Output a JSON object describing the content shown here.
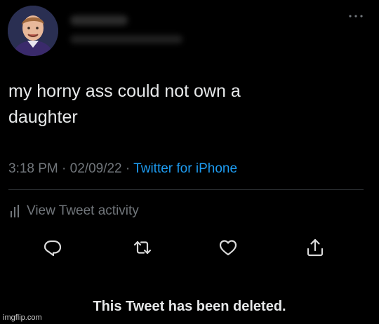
{
  "tweet": {
    "text": "my horny ass could not own a\ndaughter",
    "time": "3:18 PM",
    "separator_1": " · ",
    "date": "02/09/22",
    "separator_2": " · ",
    "source": "Twitter for iPhone"
  },
  "activity": {
    "label": "View Tweet activity"
  },
  "actions": [
    {
      "icon": "reply-icon"
    },
    {
      "icon": "retweet-icon"
    },
    {
      "icon": "like-icon"
    },
    {
      "icon": "share-icon"
    }
  ],
  "notice": {
    "text": "This Tweet has been deleted."
  },
  "watermark": {
    "text": "imgflip.com"
  },
  "colors": {
    "background": "#000000",
    "primary_text": "#e7e9ea",
    "secondary_text": "#71767b",
    "accent": "#1d9bf0",
    "divider": "#2f3336"
  }
}
